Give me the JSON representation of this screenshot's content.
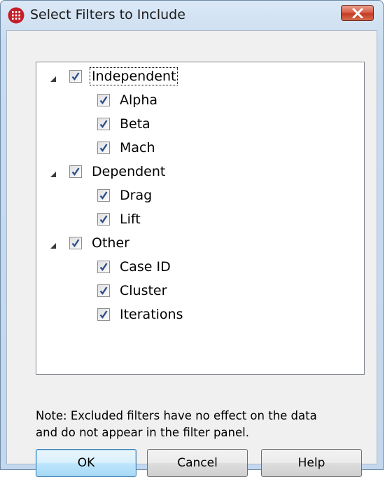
{
  "window": {
    "title": "Select Filters to Include",
    "close_symbol": "✕"
  },
  "tree": {
    "groups": [
      {
        "label": "Independent",
        "checked": true,
        "expanded": true,
        "focused": true,
        "children": [
          {
            "label": "Alpha",
            "checked": true
          },
          {
            "label": "Beta",
            "checked": true
          },
          {
            "label": "Mach",
            "checked": true
          }
        ]
      },
      {
        "label": "Dependent",
        "checked": true,
        "expanded": true,
        "children": [
          {
            "label": "Drag",
            "checked": true
          },
          {
            "label": "Lift",
            "checked": true
          }
        ]
      },
      {
        "label": "Other",
        "checked": true,
        "expanded": true,
        "children": [
          {
            "label": "Case ID",
            "checked": true
          },
          {
            "label": "Cluster",
            "checked": true
          },
          {
            "label": "Iterations",
            "checked": true
          }
        ]
      }
    ]
  },
  "note": {
    "line1": "Note: Excluded filters have no effect on the data",
    "line2": "and do not appear in the filter panel."
  },
  "buttons": {
    "ok": "OK",
    "cancel": "Cancel",
    "help": "Help"
  },
  "colors": {
    "app_icon": "#c41e2a",
    "close_button": "#c84a33",
    "checkmark": "#2e4f8a"
  }
}
